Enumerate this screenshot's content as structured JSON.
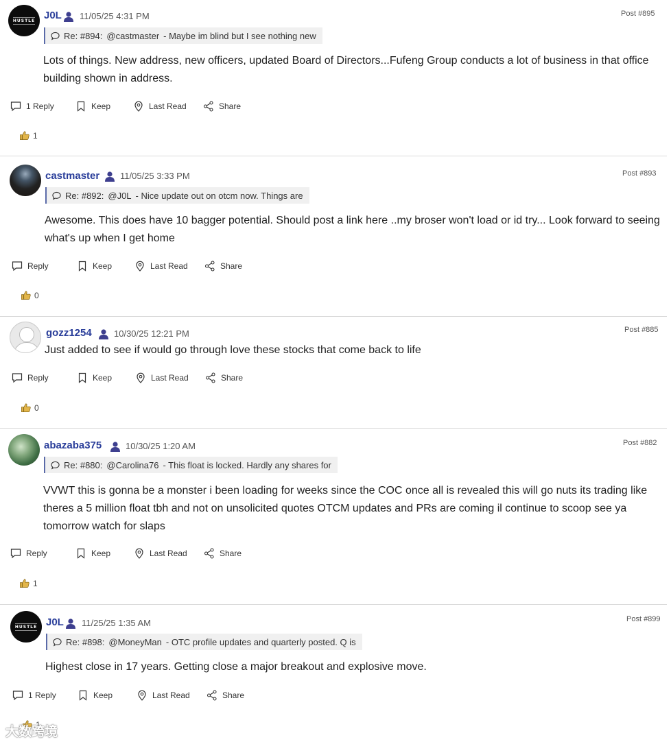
{
  "posts": [
    {
      "username": "J0L",
      "timestamp": "11/05/25 4:31 PM",
      "post_number": "Post #895",
      "avatar": "hustle-logo",
      "avatar_text": "HUSTLE",
      "reply_ref": "Re: #894:",
      "reply_mention": "@castmaster",
      "reply_snippet": "- Maybe im blind but I see nothing new",
      "content": "Lots of things.  New address, new officers, updated Board of Directors...Fufeng Group conducts a lot of business in that office building shown in address.",
      "reply_label": "1 Reply",
      "keep_label": "Keep",
      "lastread_label": "Last Read",
      "share_label": "Share",
      "likes": "1"
    },
    {
      "username": "castmaster",
      "timestamp": "11/05/25 3:33 PM",
      "post_number": "Post #893",
      "avatar": "dark-photo",
      "reply_ref": "Re: #892:",
      "reply_mention": "@J0L",
      "reply_snippet": "- Nice update out on otcm now.  Things are",
      "content": "Awesome. This does have 10 bagger potential.  Should post a link here ..my broser won't load or id try... Look forward to seeing what's up when I get home",
      "reply_label": "Reply",
      "keep_label": "Keep",
      "lastread_label": "Last Read",
      "share_label": "Share",
      "likes": "0"
    },
    {
      "username": "gozz1254",
      "timestamp": "10/30/25 12:21 PM",
      "post_number": "Post #885",
      "avatar": "default-user",
      "content": "Just added to see if would go through love these stocks that come back to life",
      "reply_label": "Reply",
      "keep_label": "Keep",
      "lastread_label": "Last Read",
      "share_label": "Share",
      "likes": "0"
    },
    {
      "username": "abazaba375",
      "timestamp": "10/30/25 1:20 AM",
      "post_number": "Post #882",
      "avatar": "nature-photo",
      "reply_ref": "Re: #880:",
      "reply_mention": "@Carolina76",
      "reply_snippet": "- This float is locked. Hardly any shares for",
      "content": "VVWT this is gonna be a monster i been loading for weeks since the COC once all is revealed this will go nuts its trading like theres a 5 million float tbh and not on unsolicited quotes OTCM updates and PRs are coming il continue to scoop see ya tomorrow watch for slaps",
      "reply_label": "Reply",
      "keep_label": "Keep",
      "lastread_label": "Last Read",
      "share_label": "Share",
      "likes": "1"
    },
    {
      "username": "J0L",
      "timestamp": "11/25/25 1:35 AM",
      "post_number": "Post #899",
      "avatar": "hustle-logo",
      "avatar_text": "HUSTLE",
      "reply_ref": "Re: #898:",
      "reply_mention": "@MoneyMan",
      "reply_snippet": "- OTC profile updates and quarterly posted. Q is",
      "content": "Highest close in 17 years.  Getting close a major breakout and explosive move.",
      "reply_label": "1 Reply",
      "keep_label": "Keep",
      "lastread_label": "Last Read",
      "share_label": "Share",
      "likes": "1"
    }
  ],
  "watermark": "大数跨境",
  "colors": {
    "username": "#2a3e9a",
    "reply_border": "#5a6aa8",
    "reply_bg": "#f0f0f0",
    "like_thumb": "#e3b64a"
  }
}
